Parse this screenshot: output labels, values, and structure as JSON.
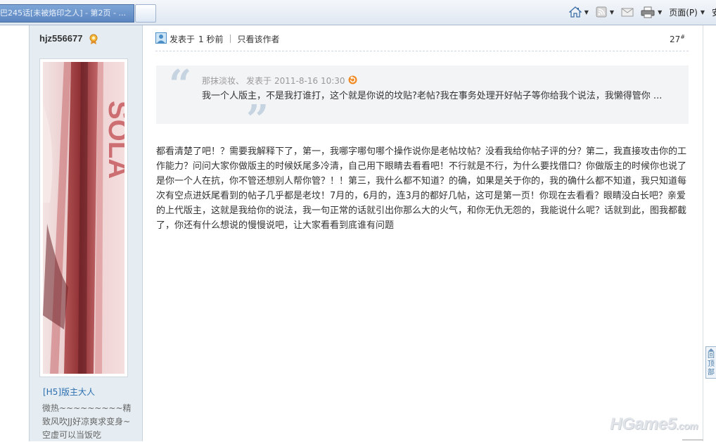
{
  "browser": {
    "active_tab_title": "巴245话[未被烙印之人] - 第2页 - ...",
    "page_menu_label": "页面(P)",
    "clipped_menu_label": "安"
  },
  "user": {
    "name": "hjz556677",
    "group": "[H5]版主大人",
    "signature": "微热~~~~~~~~~精致风吹JJ好凉爽求变身~空虚可以当饭吃"
  },
  "post": {
    "posted_prefix": "发表于",
    "posted_time": "1 秒前",
    "only_author_label": "只看该作者",
    "floor": "27",
    "floor_mark": "#",
    "quote": {
      "author": "那抹淡妆、",
      "posted_label": "发表于",
      "posted_time": "2011-8-16 10:30",
      "text": "我一个人版主，不是我打谁打，这个就是你说的坟贴?老帖?我在事务处理开好帖子等你给我个说法，我懒得管你 ..."
    },
    "body": "都看清楚了吧！？需要我解释下了，第一，我哪字哪句哪个操作说你是老帖坟帖？没看我给你帖子评的分？第二，我直接攻击你的工作能力？问问大家你做版主的时候妖尾多冷清，自己用下眼睛去看看吧！不行就是不行，为什么要找借口？你做版主的时候你也说了是你一个人在抗，你不管还想别人帮你管？！！第三，我什么都不知道？的确，如果是关于你的，我的确什么都不知道，我只知道每次有空点进妖尾看到的帖子几乎都是老坟！7月的，6月的，连3月的都好几帖，这可是第一页！你现在去看看？眼睛没白长吧？亲爱的上代版主，这就是我给你的说法，我一句正常的话就引出你那么大的火气，和你无仇无怨的，我能说什么呢？话就到此，图我都截了，你还有什么想说的慢慢说吧，让大家看看到底谁有问题"
  },
  "back_to_top": "回顶部",
  "watermark": {
    "main": "HGame5",
    "suffix": ".com"
  },
  "icons": [
    "home-icon",
    "rss-icon",
    "read-mail-icon",
    "print-icon",
    "chevron-down-icon",
    "medal-icon",
    "user-avatar-icon",
    "arrow-circle-icon"
  ],
  "colors": {
    "sidebar_bg": "#e5edf2",
    "link_blue": "#2b6fb0",
    "quote_bg": "#f3f4f6",
    "quote_marks": "#c6d3e0"
  }
}
